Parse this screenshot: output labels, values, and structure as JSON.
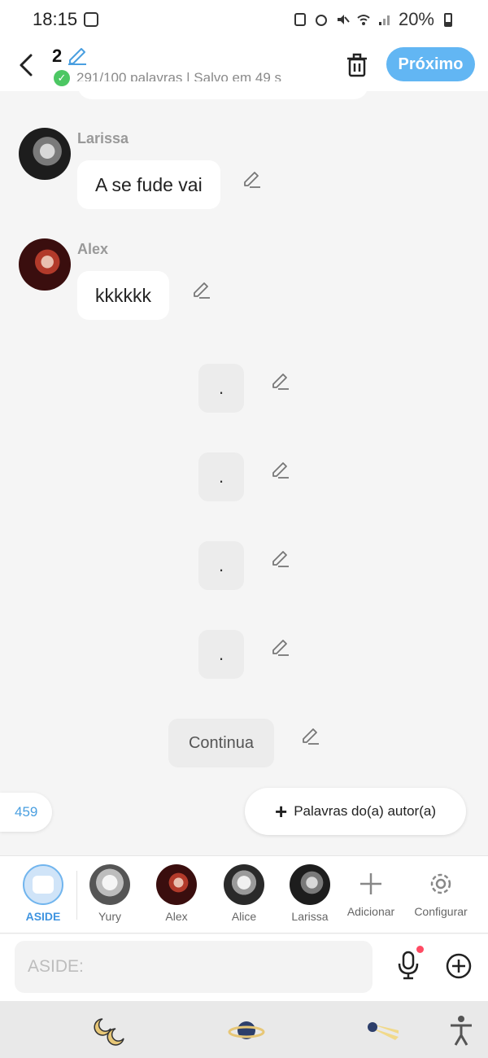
{
  "status_bar": {
    "time": "18:15",
    "battery": "20%"
  },
  "header": {
    "chapter_number": "2",
    "meta": "291/100 palavras | Salvo em 49 s",
    "next_label": "Próximo"
  },
  "messages": [
    {
      "sender": "Larissa",
      "text": "A se fude vai"
    },
    {
      "sender": "Alex",
      "text": "kkkkkk"
    }
  ],
  "narration": [
    ".",
    ".",
    ".",
    ".",
    "Continua"
  ],
  "counter": "459",
  "author_words_label": "Palavras do(a) autor(a)",
  "characters": {
    "aside_label": "ASIDE",
    "items": [
      {
        "label": "Yury"
      },
      {
        "label": "Alex"
      },
      {
        "label": "Alice"
      },
      {
        "label": "Larissa"
      }
    ],
    "add_label": "Adicionar",
    "settings_label": "Configurar"
  },
  "input": {
    "placeholder": "ASIDE:"
  },
  "colors": {
    "accent": "#62b6f3",
    "aside_blue": "#3f94e0",
    "notify_dot": "#ff4b63"
  },
  "icons": [
    "back-icon",
    "edit-pencil-icon",
    "check-icon",
    "trash-icon",
    "plus-icon",
    "gear-icon",
    "mic-icon",
    "add-circle-icon",
    "moon-icon",
    "planet-icon",
    "comet-icon",
    "accessibility-icon"
  ]
}
